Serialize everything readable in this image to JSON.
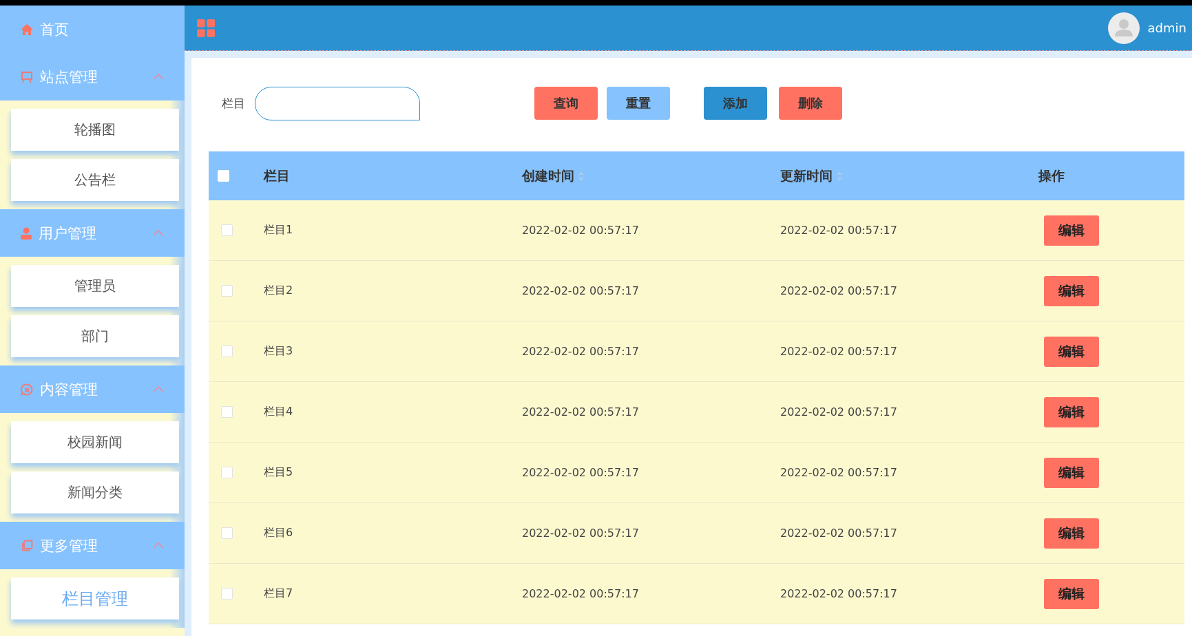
{
  "sidebar": {
    "items": [
      {
        "kind": "link",
        "label": "首页"
      },
      {
        "kind": "group",
        "label": "站点管理",
        "expanded": true,
        "children": [
          {
            "label": "轮播图",
            "selected": false
          },
          {
            "label": "公告栏",
            "selected": false
          }
        ]
      },
      {
        "kind": "group",
        "label": "用户管理",
        "expanded": true,
        "children": [
          {
            "label": "管理员",
            "selected": false
          },
          {
            "label": "部门",
            "selected": false
          }
        ]
      },
      {
        "kind": "group",
        "label": "内容管理",
        "expanded": true,
        "children": [
          {
            "label": "校园新闻",
            "selected": false
          },
          {
            "label": "新闻分类",
            "selected": false
          }
        ]
      },
      {
        "kind": "group",
        "label": "更多管理",
        "expanded": true,
        "children": [
          {
            "label": "栏目管理",
            "selected": true
          }
        ]
      }
    ]
  },
  "header": {
    "user": "admin"
  },
  "search": {
    "label": "栏目"
  },
  "buttons": [
    {
      "kind": "search",
      "label": "查询"
    },
    {
      "kind": "reset",
      "label": "重置"
    },
    {
      "kind": "add",
      "label": "添加"
    },
    {
      "kind": "delete",
      "label": "删除"
    }
  ],
  "table": {
    "select_all": {
      "checked": false
    },
    "columns": [
      {
        "label": "栏目",
        "sortable": false
      },
      {
        "label": "创建时间",
        "sortable": true
      },
      {
        "label": "更新时间",
        "sortable": true
      },
      {
        "label": "操作",
        "sortable": false
      }
    ],
    "rows": [
      {
        "checked": false,
        "name": "栏目1",
        "created": "2022-02-02 00:57:17",
        "updated": "2022-02-02 00:57:17",
        "action": "编辑"
      },
      {
        "checked": false,
        "name": "栏目2",
        "created": "2022-02-02 00:57:17",
        "updated": "2022-02-02 00:57:17",
        "action": "编辑"
      },
      {
        "checked": false,
        "name": "栏目3",
        "created": "2022-02-02 00:57:17",
        "updated": "2022-02-02 00:57:17",
        "action": "编辑"
      },
      {
        "checked": false,
        "name": "栏目4",
        "created": "2022-02-02 00:57:17",
        "updated": "2022-02-02 00:57:17",
        "action": "编辑"
      },
      {
        "checked": false,
        "name": "栏目5",
        "created": "2022-02-02 00:57:17",
        "updated": "2022-02-02 00:57:17",
        "action": "编辑"
      },
      {
        "checked": false,
        "name": "栏目6",
        "created": "2022-02-02 00:57:17",
        "updated": "2022-02-02 00:57:17",
        "action": "编辑"
      },
      {
        "checked": false,
        "name": "栏目7",
        "created": "2022-02-02 00:57:17",
        "updated": "2022-02-02 00:57:17",
        "action": "编辑"
      }
    ]
  }
}
